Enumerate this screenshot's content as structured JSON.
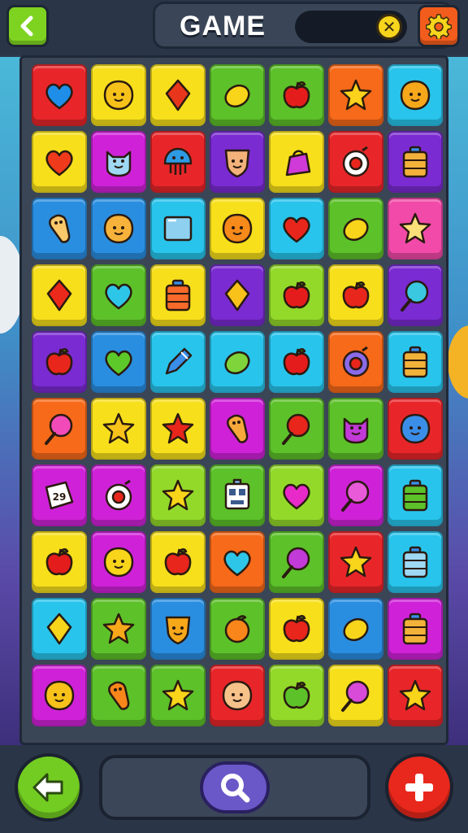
{
  "header": {
    "title": "GAME",
    "back_icon": "chevron-left-icon",
    "settings_icon": "gear-icon",
    "coin_icon": "coin-icon"
  },
  "colors": {
    "red": "#e8262a",
    "yellow": "#f7df1c",
    "orange": "#f66a1a",
    "green": "#5dc12a",
    "lime": "#93d92a",
    "cyan": "#28c4ec",
    "blue": "#2a8ee0",
    "purple": "#7a2bd1",
    "magenta": "#cf22d8",
    "pink": "#f24aa8"
  },
  "board": {
    "rows": [
      [
        {
          "bg": "red",
          "icon": "heart-icon",
          "fill": "#1e8ee8"
        },
        {
          "bg": "yellow",
          "icon": "smiley-icon",
          "fill": "#f6c21a"
        },
        {
          "bg": "yellow",
          "icon": "diamond-icon",
          "fill": "#e8361c"
        },
        {
          "bg": "green",
          "icon": "lemon-icon",
          "fill": "#f8d41a"
        },
        {
          "bg": "green",
          "icon": "apple-icon",
          "fill": "#e51c1c"
        },
        {
          "bg": "orange",
          "icon": "star-icon",
          "fill": "#fbd21c"
        },
        {
          "bg": "cyan",
          "icon": "smiley-icon",
          "fill": "#f6a81a"
        }
      ],
      [
        {
          "bg": "yellow",
          "icon": "heart-icon",
          "fill": "#ef3a1c"
        },
        {
          "bg": "magenta",
          "icon": "cat-icon",
          "fill": "#9ed8f2"
        },
        {
          "bg": "red",
          "icon": "jellyfish-icon",
          "fill": "#2e9ae4"
        },
        {
          "bg": "purple",
          "icon": "shield-icon",
          "fill": "#f2b27a"
        },
        {
          "bg": "yellow",
          "icon": "bag-icon",
          "fill": "#cf3ad8"
        },
        {
          "bg": "red",
          "icon": "ring-icon",
          "fill": "#ffffff"
        },
        {
          "bg": "purple",
          "icon": "jar-icon",
          "fill": "#f2b23a"
        }
      ],
      [
        {
          "bg": "blue",
          "icon": "bone-icon",
          "fill": "#f8c86a"
        },
        {
          "bg": "blue",
          "icon": "smiley-icon",
          "fill": "#f6b23a"
        },
        {
          "bg": "cyan",
          "icon": "box-icon",
          "fill": "#8ed0f0"
        },
        {
          "bg": "yellow",
          "icon": "smiley-icon",
          "fill": "#f68a1a"
        },
        {
          "bg": "cyan",
          "icon": "heart-icon",
          "fill": "#e8261c"
        },
        {
          "bg": "green",
          "icon": "lemon-icon",
          "fill": "#f8d41a"
        },
        {
          "bg": "pink",
          "icon": "star-icon",
          "fill": "#fbe07a"
        }
      ],
      [
        {
          "bg": "yellow",
          "icon": "diamond-icon",
          "fill": "#ec2a1c"
        },
        {
          "bg": "green",
          "icon": "heart-icon",
          "fill": "#2ec6e8"
        },
        {
          "bg": "yellow",
          "icon": "jar-icon",
          "fill": "#f86a2a"
        },
        {
          "bg": "purple",
          "icon": "diamond-icon",
          "fill": "#f8c21a"
        },
        {
          "bg": "lime",
          "icon": "apple-icon",
          "fill": "#e51c1c"
        },
        {
          "bg": "yellow",
          "icon": "apple-icon",
          "fill": "#e8261c"
        },
        {
          "bg": "purple",
          "icon": "lollipop-icon",
          "fill": "#3ac8e0"
        }
      ],
      [
        {
          "bg": "purple",
          "icon": "apple-icon",
          "fill": "#e8261c"
        },
        {
          "bg": "blue",
          "icon": "heart-icon",
          "fill": "#5dc82a"
        },
        {
          "bg": "cyan",
          "icon": "pencil-icon",
          "fill": "#3a8ee8"
        },
        {
          "bg": "cyan",
          "icon": "lemon-icon",
          "fill": "#7ed43a"
        },
        {
          "bg": "cyan",
          "icon": "apple-icon",
          "fill": "#e51c1c"
        },
        {
          "bg": "orange",
          "icon": "ring-icon",
          "fill": "#8a6ae8"
        },
        {
          "bg": "cyan",
          "icon": "jar-icon",
          "fill": "#f2b23a"
        }
      ],
      [
        {
          "bg": "orange",
          "icon": "lollipop-icon",
          "fill": "#f24ab8"
        },
        {
          "bg": "yellow",
          "icon": "star-icon",
          "fill": "#f8c21a"
        },
        {
          "bg": "yellow",
          "icon": "star-icon",
          "fill": "#e8261c"
        },
        {
          "bg": "magenta",
          "icon": "bone-icon",
          "fill": "#f6a83a"
        },
        {
          "bg": "green",
          "icon": "lollipop-icon",
          "fill": "#e8261c"
        },
        {
          "bg": "green",
          "icon": "cat-icon",
          "fill": "#c23ad8"
        },
        {
          "bg": "red",
          "icon": "smiley-icon",
          "fill": "#3a8ee8"
        }
      ],
      [
        {
          "bg": "magenta",
          "icon": "tag-icon",
          "fill": "#ffffff"
        },
        {
          "bg": "magenta",
          "icon": "ring-icon",
          "fill": "#ffffff"
        },
        {
          "bg": "lime",
          "icon": "star-icon",
          "fill": "#f8d41a"
        },
        {
          "bg": "green",
          "icon": "robot-icon",
          "fill": "#ffffff"
        },
        {
          "bg": "lime",
          "icon": "heart-icon",
          "fill": "#e82ac8"
        },
        {
          "bg": "magenta",
          "icon": "lollipop-icon",
          "fill": "#e85ad8"
        },
        {
          "bg": "cyan",
          "icon": "jar-icon",
          "fill": "#5dc12a"
        }
      ],
      [
        {
          "bg": "yellow",
          "icon": "apple-icon",
          "fill": "#e51c1c"
        },
        {
          "bg": "magenta",
          "icon": "smiley-icon",
          "fill": "#f8d41a"
        },
        {
          "bg": "yellow",
          "icon": "apple-icon",
          "fill": "#e8261c"
        },
        {
          "bg": "orange",
          "icon": "heart-icon",
          "fill": "#2ec6e8"
        },
        {
          "bg": "green",
          "icon": "lollipop-icon",
          "fill": "#c23ad8"
        },
        {
          "bg": "red",
          "icon": "star-icon",
          "fill": "#f8d41a"
        },
        {
          "bg": "cyan",
          "icon": "jar-icon",
          "fill": "#9ed8f2"
        }
      ],
      [
        {
          "bg": "cyan",
          "icon": "diamond-icon",
          "fill": "#f8d41a"
        },
        {
          "bg": "green",
          "icon": "star-icon",
          "fill": "#f6a81a"
        },
        {
          "bg": "blue",
          "icon": "shield-icon",
          "fill": "#f6a81a"
        },
        {
          "bg": "green",
          "icon": "orange-icon",
          "fill": "#f8861a"
        },
        {
          "bg": "yellow",
          "icon": "apple-icon",
          "fill": "#e8261c"
        },
        {
          "bg": "blue",
          "icon": "lemon-icon",
          "fill": "#f8d41a"
        },
        {
          "bg": "magenta",
          "icon": "jar-icon",
          "fill": "#f2b23a"
        }
      ],
      [
        {
          "bg": "magenta",
          "icon": "smiley-icon",
          "fill": "#f8c21a"
        },
        {
          "bg": "green",
          "icon": "bone-icon",
          "fill": "#f8861a"
        },
        {
          "bg": "green",
          "icon": "star-icon",
          "fill": "#f8d41a"
        },
        {
          "bg": "red",
          "icon": "smiley-icon",
          "fill": "#f6c28a"
        },
        {
          "bg": "lime",
          "icon": "apple-icon",
          "fill": "#5dc12a"
        },
        {
          "bg": "yellow",
          "icon": "lollipop-icon",
          "fill": "#d84ad8"
        },
        {
          "bg": "red",
          "icon": "star-icon",
          "fill": "#f8d41a"
        }
      ]
    ]
  },
  "footer": {
    "undo_icon": "arrow-left-icon",
    "search_icon": "search-icon",
    "add_icon": "plus-icon"
  }
}
